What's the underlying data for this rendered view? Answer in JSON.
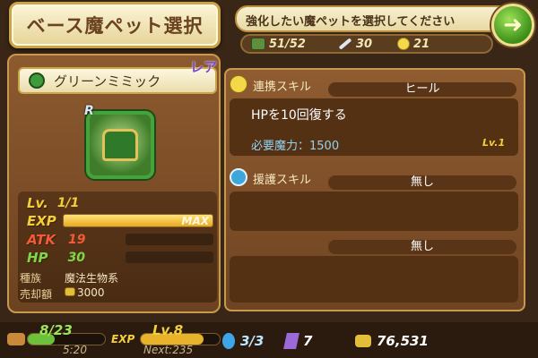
{
  "header": {
    "title": "ベース魔ペット選択",
    "message": "強化したい魔ペットを選択してください",
    "resources": {
      "storage": "51/52",
      "swords": "30",
      "chicks": "21"
    },
    "back_icon": "back-arrow-icon"
  },
  "pet": {
    "name": "グリーンミミック",
    "rarity": "レア",
    "rank": "R",
    "level_label": "Lv.",
    "level": "1/1",
    "exp_label": "EXP",
    "exp_text": "MAX",
    "exp_fraction": 1.0,
    "atk_label": "ATK",
    "atk": "19",
    "hp_label": "HP",
    "hp": "30",
    "species_label": "種族",
    "species": "魔法生物系",
    "sell_label": "売却額",
    "sell_price": "3000"
  },
  "linked_skill": {
    "title": "連携スキル",
    "name": "ヒール",
    "description": "HPを10回復する",
    "mana": "必要魔力：1500",
    "level": "Lv.1"
  },
  "support_skill": {
    "title": "援護スキル",
    "slot1": "無し",
    "slot2": "無し"
  },
  "footer": {
    "stamina": "8/23",
    "stamina_time": "5:20",
    "exp_label": "EXP",
    "player_level": "Lv.8",
    "next_exp": "Next:235",
    "gems": "3/3",
    "crystals": "7",
    "gold": "76,531"
  },
  "colors": {
    "accent_green": "#46a23b",
    "gold": "#f3cf3a",
    "red": "#f25b3a",
    "mana_blue": "#8fd3f4"
  }
}
